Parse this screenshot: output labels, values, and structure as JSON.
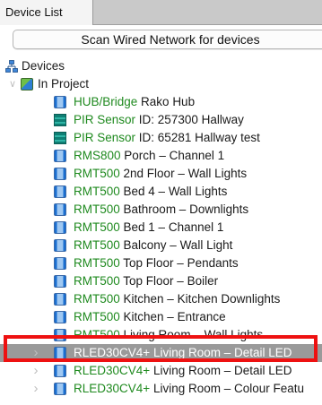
{
  "tab": {
    "label": "Device List"
  },
  "scan_button": {
    "label": "Scan Wired Network for devices"
  },
  "tree": {
    "root": {
      "label": "Devices",
      "icon": "network-icon"
    },
    "project": {
      "label": "In Project",
      "icon": "project-icon",
      "expander": "chevron-down-icon"
    },
    "devices": [
      {
        "type": "HUB/Bridge",
        "name": "Rako Hub",
        "icon": "hub-icon"
      },
      {
        "type": "PIR Sensor",
        "name": "ID: 257300 Hallway",
        "icon": "pir-sensor-icon"
      },
      {
        "type": "PIR Sensor",
        "name": "ID: 65281 Hallway test",
        "icon": "pir-sensor-icon"
      },
      {
        "type": "RMS800",
        "name": "Porch – Channel 1",
        "icon": "device-icon"
      },
      {
        "type": "RMT500",
        "name": "2nd Floor – Wall Lights",
        "icon": "device-icon"
      },
      {
        "type": "RMT500",
        "name": "Bed 4 – Wall Lights",
        "icon": "device-icon"
      },
      {
        "type": "RMT500",
        "name": "Bathroom – Downlights",
        "icon": "device-icon"
      },
      {
        "type": "RMT500",
        "name": "Bed 1 – Channel 1",
        "icon": "device-icon"
      },
      {
        "type": "RMT500",
        "name": "Balcony – Wall Light",
        "icon": "device-icon"
      },
      {
        "type": "RMT500",
        "name": "Top Floor – Pendants",
        "icon": "device-icon"
      },
      {
        "type": "RMT500",
        "name": "Top Floor – Boiler",
        "icon": "device-icon"
      },
      {
        "type": "RMT500",
        "name": "Kitchen – Kitchen Downlights",
        "icon": "device-icon"
      },
      {
        "type": "RMT500",
        "name": "Kitchen – Entrance",
        "icon": "device-icon"
      },
      {
        "type": "RMT500",
        "name": "Living Room – Wall Lights",
        "icon": "device-icon"
      },
      {
        "type": "RLED30CV4+",
        "name": "Living Room – Detail LED",
        "icon": "device-icon",
        "selected": true,
        "expander": "chevron-right-icon"
      },
      {
        "type": "RLED30CV4+",
        "name": "Living Room – Detail LED",
        "icon": "device-icon",
        "expander": "chevron-right-icon"
      },
      {
        "type": "RLED30CV4+",
        "name": "Living Room – Colour Featu",
        "icon": "device-icon",
        "expander": "chevron-right-icon"
      }
    ]
  },
  "colors": {
    "type_text": "#1f8a1f",
    "selection": "#9a9a9a",
    "highlight_box": "#ee1111"
  }
}
